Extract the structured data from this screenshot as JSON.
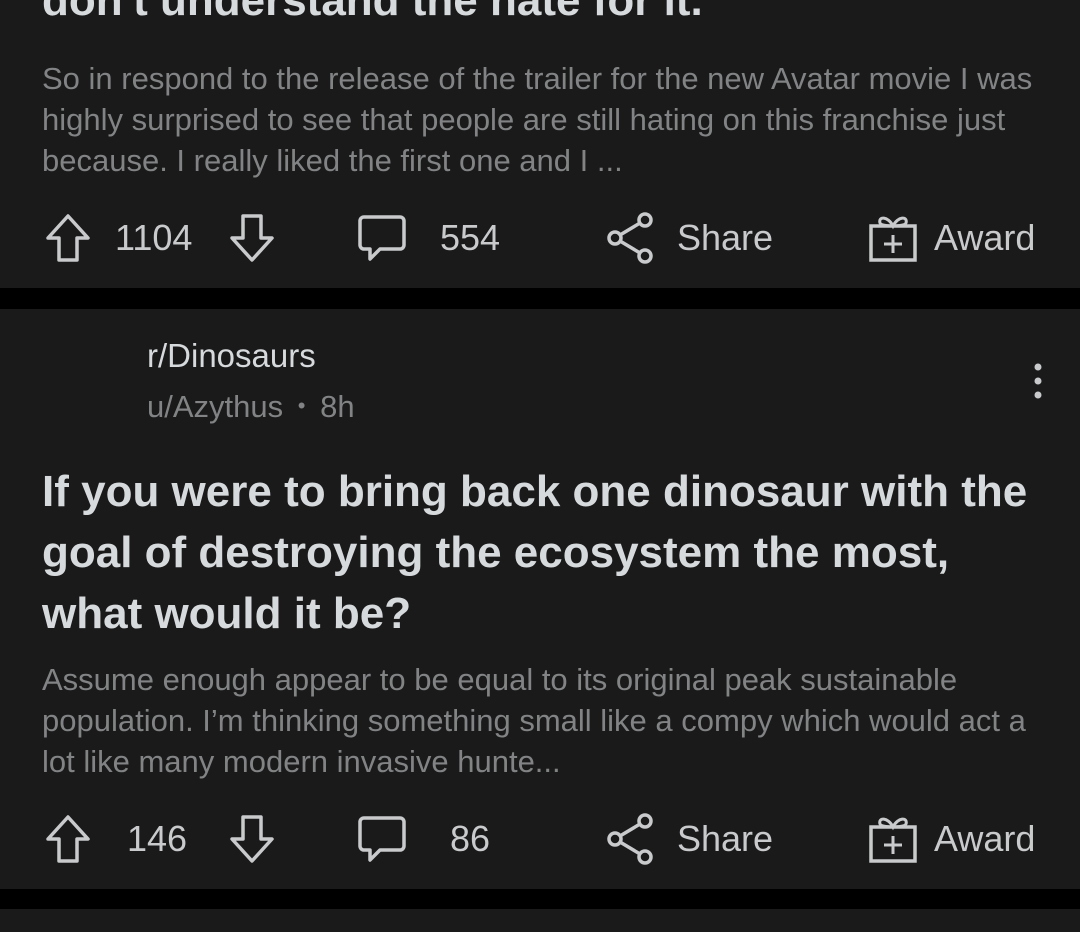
{
  "posts": [
    {
      "title": "don't understand the hate for it.",
      "body": "So in respond to the release of the trailer for the new Avatar movie I was highly surprised to see that people are still hating on this franchise just because. I really liked the first one and I ...",
      "votes": "1104",
      "comments": "554",
      "share_label": "Share",
      "award_label": "Award"
    },
    {
      "subreddit": "r/Dinosaurs",
      "author": "u/Azythus",
      "separator": "•",
      "age": "8h",
      "title": "If you were to bring back one dinosaur with the goal of destroying the ecosystem the most, what would it be?",
      "body": "Assume enough appear to be equal to its original peak sustainable population. I’m thinking something small like a compy which would act a lot like many modern invasive hunte...",
      "votes": "146",
      "comments": "86",
      "share_label": "Share",
      "award_label": "Award"
    }
  ],
  "colors": {
    "background": "#000000",
    "card": "#1a1a1b",
    "title_text": "#d7dadc",
    "body_text": "#818384",
    "icon": "#c8cacc"
  },
  "icons": {
    "upvote": "arrow-up-icon",
    "downvote": "arrow-down-icon",
    "comment": "speech-bubble-icon",
    "share": "share-nodes-icon",
    "award": "gift-box-icon",
    "more": "vertical-ellipsis-icon"
  }
}
